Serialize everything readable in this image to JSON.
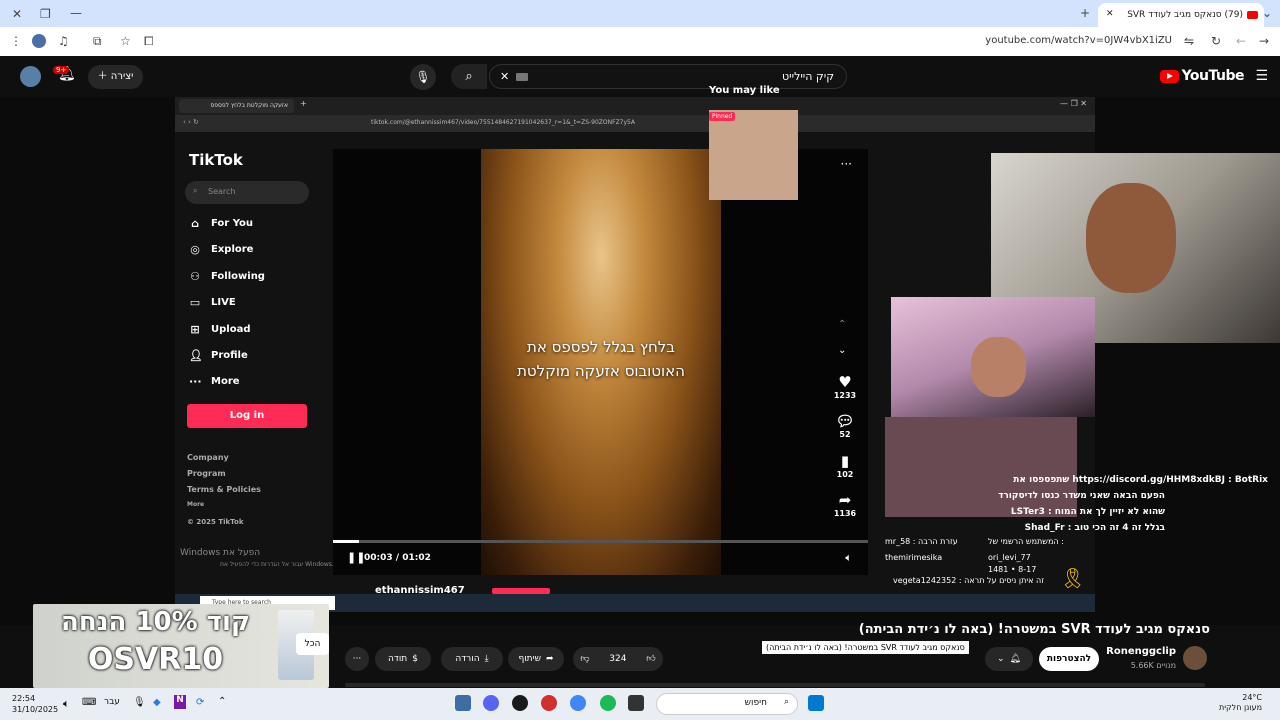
{
  "browser": {
    "tab_title": "(79) סנאקס מגיב לעודד SVR",
    "url": "youtube.com/watch?v=0JW4vbX1iZU"
  },
  "youtube": {
    "search_value": "קיק היילייט",
    "create_label": "יצירה",
    "notifications_badge": "9+",
    "logo_text": "YouTube"
  },
  "tiktok": {
    "tab_title": "אזעקה מוקלטת בלחץ לפספס",
    "url": "tiktok.com/@ethannissim467/video/7551484627191042637_r=1&_t=ZS-90ZONFZ7y5A",
    "logo": "TikTok",
    "search_placeholder": "Search",
    "nav": [
      "For You",
      "Explore",
      "Following",
      "LIVE",
      "Upload",
      "Profile",
      "More"
    ],
    "login_label": "Log in",
    "footer": [
      "Company",
      "Program",
      "Terms & Policies",
      "More",
      "© 2025 TikTok"
    ],
    "caption_line1": "בלחץ בגלל לפספס את",
    "caption_line2": "האוטובוס אזעקה מוקלטת",
    "time": "00:03 / 01:02",
    "likes": "1233",
    "comments": "52",
    "saves": "102",
    "shares": "1136",
    "you_may_like": "You may like",
    "pinned": "Pinned",
    "author": "ethannissim467"
  },
  "windows_watermark": {
    "line1": "Windows הפעל את",
    "line2": "עבור אל הגדרות כדי להפעיל את Windows."
  },
  "chat": [
    "https://discord.gg/HHM8xdkBJ : BotRix שתפספסו את",
    "הפעם הבאה שאני משדר כנסו לדיסקורד",
    "שהוא לא יזיין לך את המוח : LSTer3",
    "בגלל זה 4 זה הכי טוב : Shad_Fr",
    "המשתמש הרשמי של :",
    "mr_58 : עזרת הרבה",
    "themirimesika",
    "ori_levi_77",
    "1481 • 8-17",
    "vegeta1242352 : זה איתן ניסים על תראה"
  ],
  "ad": {
    "line1": "קוד 10% הנחה",
    "line2": "OSVR10",
    "all_button": "הכל"
  },
  "video": {
    "title": "סנאקס מגיב לעודד SVR במשטרה! (באה לו נ׳ידת הביתה)",
    "tooltip": "סנאקס מגיב לעודד SVR במשטרה! (באה לו נ׳ידת הביתה)",
    "channel": "Ronenggclip",
    "subscribers": "5.66K מנויים",
    "subscribe_label": "להצטרפות",
    "like_count": "324",
    "share_label": "שיתוף",
    "download_label": "הורדה",
    "thanks_label": "תודה"
  },
  "taskbar": {
    "time": "22:54",
    "date": "31/10/2025",
    "lang": "עבר",
    "search_placeholder": "חיפוש",
    "temp": "24°C",
    "weather_desc": "מעונן חלקית"
  }
}
